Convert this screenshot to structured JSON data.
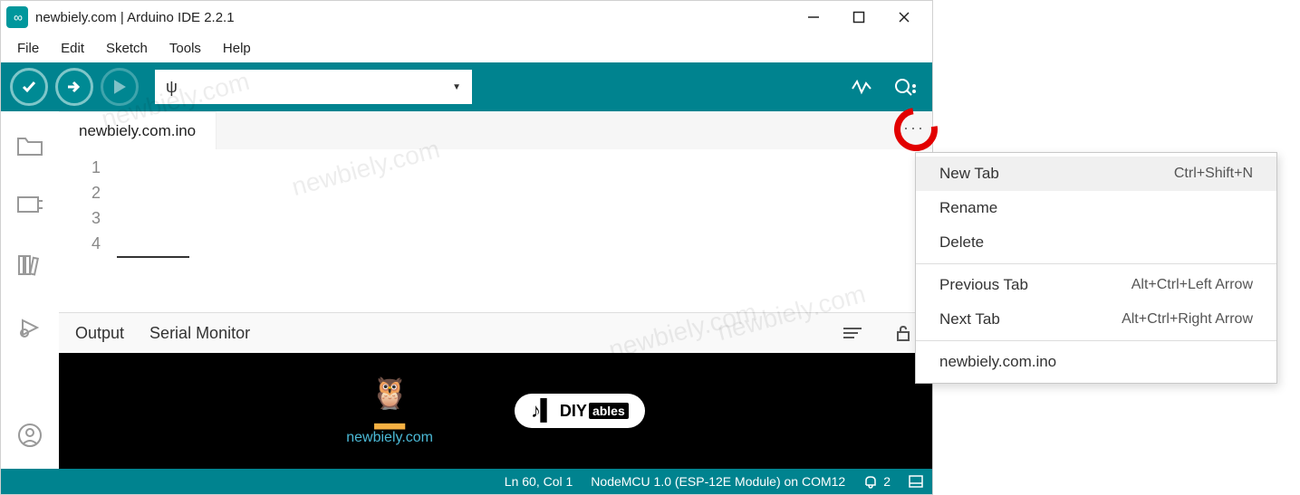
{
  "title": "newbiely.com | Arduino IDE 2.2.1",
  "menubar": [
    "File",
    "Edit",
    "Sketch",
    "Tools",
    "Help"
  ],
  "board_select": {
    "icon": "usb"
  },
  "tab": {
    "name": "newbiely.com.ino"
  },
  "gutter_lines": [
    "1",
    "2",
    "3",
    "4"
  ],
  "panels": {
    "output": "Output",
    "serial": "Serial Monitor"
  },
  "brand": {
    "newbiely": "newbiely.com",
    "diy_prefix": "♪▍",
    "diy": "DIY",
    "diy_sub": "ables"
  },
  "statusbar": {
    "position": "Ln 60, Col 1",
    "board": "NodeMCU 1.0 (ESP-12E Module) on COM12",
    "notif_count": "2"
  },
  "context_menu": [
    {
      "label": "New Tab",
      "shortcut": "Ctrl+Shift+N",
      "highlight": true
    },
    {
      "label": "Rename",
      "shortcut": ""
    },
    {
      "label": "Delete",
      "shortcut": ""
    },
    {
      "sep": true
    },
    {
      "label": "Previous Tab",
      "shortcut": "Alt+Ctrl+Left Arrow"
    },
    {
      "label": "Next Tab",
      "shortcut": "Alt+Ctrl+Right Arrow"
    },
    {
      "sep": true
    },
    {
      "label": "newbiely.com.ino",
      "shortcut": ""
    }
  ],
  "watermark": "newbiely.com"
}
